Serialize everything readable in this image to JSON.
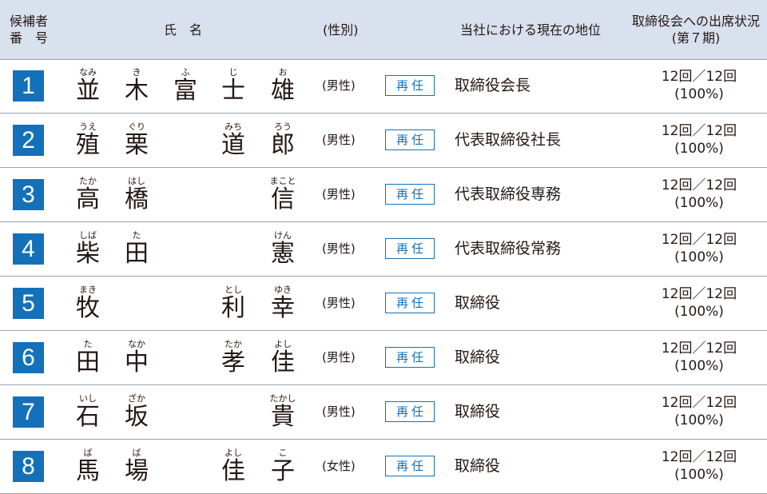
{
  "header": {
    "number_line1": "候補者",
    "number_line2": "番　号",
    "name": "氏　名",
    "gender": "(性別)",
    "position": "当社における現在の地位",
    "attendance_line1": "取締役会への出席状況",
    "attendance_line2": "(第７期)"
  },
  "rows": [
    {
      "number": "1",
      "c1": "並",
      "r1": "なみ",
      "c2": "木",
      "r2": "き",
      "c3": "富",
      "r3": "ふ",
      "c4": "士",
      "r4": "じ",
      "c5": "雄",
      "r5": "お",
      "gender": "(男性)",
      "status": "再任",
      "position": "取締役会長",
      "attendance": "12回／12回",
      "rate": "(100%)"
    },
    {
      "number": "2",
      "c1": "殖",
      "r1": "うえ",
      "c2": "栗",
      "r2": "ぐり",
      "c3": "",
      "r3": "",
      "c4": "道",
      "r4": "みち",
      "c5": "郎",
      "r5": "ろう",
      "gender": "(男性)",
      "status": "再任",
      "position": "代表取締役社長",
      "attendance": "12回／12回",
      "rate": "(100%)"
    },
    {
      "number": "3",
      "c1": "高",
      "r1": "たか",
      "c2": "橋",
      "r2": "はし",
      "c3": "",
      "r3": "",
      "c4": "",
      "r4": "",
      "c5": "信",
      "r5": "まこと",
      "gender": "(男性)",
      "status": "再任",
      "position": "代表取締役専務",
      "attendance": "12回／12回",
      "rate": "(100%)"
    },
    {
      "number": "4",
      "c1": "柴",
      "r1": "しば",
      "c2": "田",
      "r2": "た",
      "c3": "",
      "r3": "",
      "c4": "",
      "r4": "",
      "c5": "憲",
      "r5": "けん",
      "gender": "(男性)",
      "status": "再任",
      "position": "代表取締役常務",
      "attendance": "12回／12回",
      "rate": "(100%)"
    },
    {
      "number": "5",
      "c1": "牧",
      "r1": "まき",
      "c2": "",
      "r2": "",
      "c3": "",
      "r3": "",
      "c4": "利",
      "r4": "とし",
      "c5": "幸",
      "r5": "ゆき",
      "gender": "(男性)",
      "status": "再任",
      "position": "取締役",
      "attendance": "12回／12回",
      "rate": "(100%)"
    },
    {
      "number": "6",
      "c1": "田",
      "r1": "た",
      "c2": "中",
      "r2": "なか",
      "c3": "",
      "r3": "",
      "c4": "孝",
      "r4": "たか",
      "c5": "佳",
      "r5": "よし",
      "gender": "(男性)",
      "status": "再任",
      "position": "取締役",
      "attendance": "12回／12回",
      "rate": "(100%)"
    },
    {
      "number": "7",
      "c1": "石",
      "r1": "いし",
      "c2": "坂",
      "r2": "ざか",
      "c3": "",
      "r3": "",
      "c4": "",
      "r4": "",
      "c5": "貴",
      "r5": "たかし",
      "gender": "(男性)",
      "status": "再任",
      "position": "取締役",
      "attendance": "12回／12回",
      "rate": "(100%)"
    },
    {
      "number": "8",
      "c1": "馬",
      "r1": "ば",
      "c2": "場",
      "r2": "ば",
      "c3": "",
      "r3": "",
      "c4": "佳",
      "r4": "よし",
      "c5": "子",
      "r5": "こ",
      "gender": "(女性)",
      "status": "再任",
      "position": "取締役",
      "attendance": "12回／12回",
      "rate": "(100%)"
    }
  ],
  "colors": {
    "number_box": "#1470b8",
    "header_bg": "#d9e0ee",
    "badge": "#1470b8"
  }
}
